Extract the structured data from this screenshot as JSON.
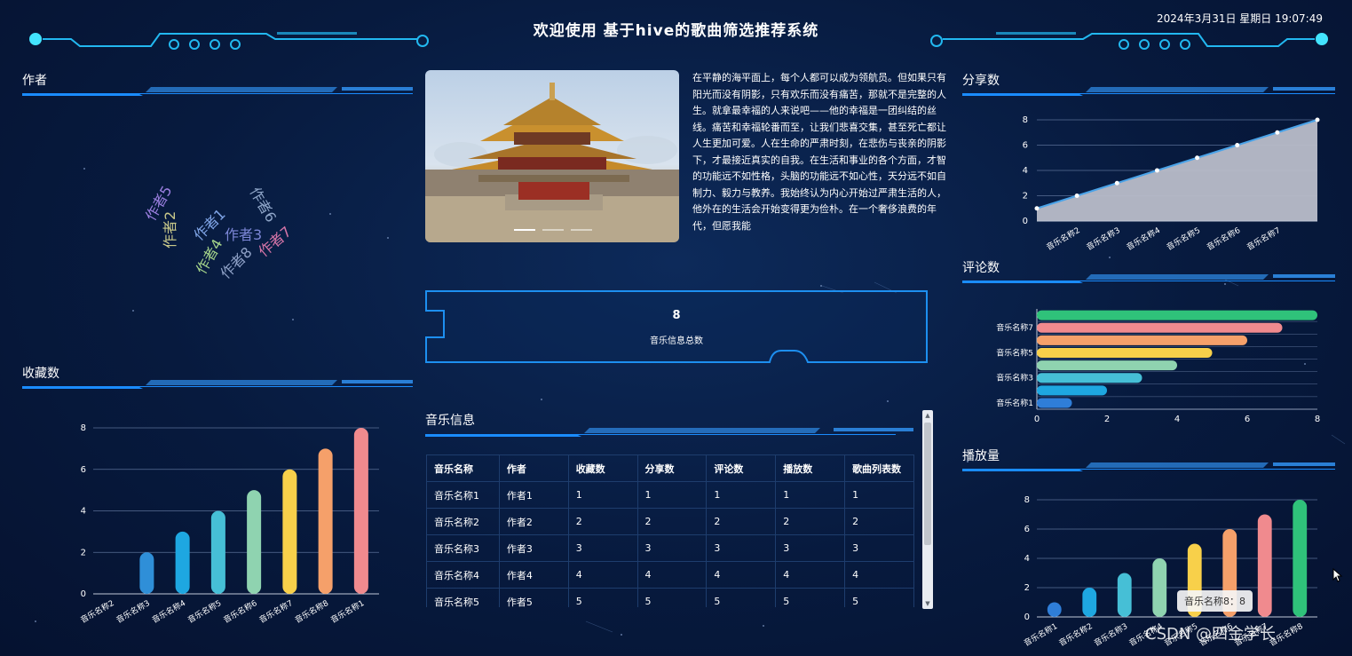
{
  "header": {
    "title": "欢迎使用 基于hive的歌曲筛选推荐系统",
    "datetime": "2024年3月31日 星期日 19:07:49"
  },
  "sections": {
    "author": "作者",
    "favorites": "收藏数",
    "shares": "分享数",
    "comments": "评论数",
    "plays": "播放量",
    "music_info": "音乐信息"
  },
  "intro_text": "在平静的海平面上，每个人都可以成为领航员。但如果只有阳光而没有阴影，只有欢乐而没有痛苦，那就不是完整的人生。就拿最幸福的人来说吧——他的幸福是一团纠结的丝线。痛苦和幸福轮番而至，让我们悲喜交集，甚至死亡都让人生更加可爱。人在生命的严肃时刻，在悲伤与丧亲的阴影下，才最接近真实的自我。在生活和事业的各个方面，才智的功能远不如性格，头脑的功能远不如心性，天分远不如自制力、毅力与教养。我始终认为内心开始过严肃生活的人，他外在的生活会开始变得更为俭朴。在一个奢侈浪费的年代，但愿我能",
  "total": {
    "count": "8",
    "label": "音乐信息总数"
  },
  "word_cloud": [
    {
      "text": "作者5",
      "color": "#9b7fe0"
    },
    {
      "text": "作者2",
      "color": "#c9c98a"
    },
    {
      "text": "作者1",
      "color": "#7fa4e6"
    },
    {
      "text": "作者3",
      "color": "#7b86d6"
    },
    {
      "text": "作者6",
      "color": "#8fa6c9"
    },
    {
      "text": "作者4",
      "color": "#a5d48a"
    },
    {
      "text": "作者8",
      "color": "#8ea0c6"
    },
    {
      "text": "作者7",
      "color": "#d675a8"
    }
  ],
  "table": {
    "headers": [
      "音乐名称",
      "作者",
      "收藏数",
      "分享数",
      "评论数",
      "播放数",
      "歌曲列表数"
    ],
    "rows": [
      [
        "音乐名称1",
        "作者1",
        "1",
        "1",
        "1",
        "1",
        "1"
      ],
      [
        "音乐名称2",
        "作者2",
        "2",
        "2",
        "2",
        "2",
        "2"
      ],
      [
        "音乐名称3",
        "作者3",
        "3",
        "3",
        "3",
        "3",
        "3"
      ],
      [
        "音乐名称4",
        "作者4",
        "4",
        "4",
        "4",
        "4",
        "4"
      ],
      [
        "音乐名称5",
        "作者5",
        "5",
        "5",
        "5",
        "5",
        "5"
      ]
    ]
  },
  "tooltip": "音乐名称8：8",
  "watermark": "CSDN @四金学长",
  "chart_data": [
    {
      "id": "favorites",
      "type": "bar",
      "categories": [
        "音乐名称2",
        "音乐名称3",
        "音乐名称4",
        "音乐名称5",
        "音乐名称6",
        "音乐名称7",
        "音乐名称8",
        "音乐名称1"
      ],
      "values": [
        0,
        2,
        3,
        4,
        5,
        6,
        7,
        8
      ],
      "ylim": [
        0,
        8
      ],
      "yticks": [
        0,
        2,
        4,
        6,
        8
      ],
      "colors": [
        "#2f7ed8",
        "#2f8fd8",
        "#1ea7e1",
        "#46bfd6",
        "#8fd3b0",
        "#f8d04a",
        "#f5a06a",
        "#f08a8e"
      ],
      "grid": true
    },
    {
      "id": "shares",
      "type": "area",
      "categories": [
        "音乐名称1",
        "音乐名称2",
        "音乐名称3",
        "音乐名称4",
        "音乐名称5",
        "音乐名称6",
        "音乐名称7",
        "音乐名称8"
      ],
      "values": [
        1,
        2,
        3,
        4,
        5,
        6,
        7,
        8
      ],
      "ylim": [
        0,
        8
      ],
      "yticks": [
        0,
        2,
        4,
        6,
        8
      ],
      "shown_tick_labels": [
        "音乐名称2",
        "音乐名称3",
        "音乐名称4",
        "音乐名称5",
        "音乐名称6",
        "音乐名称7"
      ],
      "line_color": "#4aa3e8",
      "fill_color": "#b9bdc9",
      "grid": true
    },
    {
      "id": "comments",
      "type": "bar",
      "orientation": "horizontal",
      "categories": [
        "音乐名称1",
        "音乐名称2",
        "音乐名称3",
        "音乐名称4",
        "音乐名称5",
        "音乐名称6",
        "音乐名称7",
        "音乐名称8"
      ],
      "values": [
        1,
        2,
        3,
        4,
        5,
        6,
        7,
        8
      ],
      "xlim": [
        0,
        8
      ],
      "xticks": [
        0,
        2,
        4,
        6,
        8
      ],
      "shown_tick_labels": [
        "音乐名称1",
        "音乐名称3",
        "音乐名称5",
        "音乐名称7"
      ],
      "colors": [
        "#2f7ed8",
        "#1ea7e1",
        "#46bfd6",
        "#8fd3b0",
        "#f8d04a",
        "#f5a06a",
        "#f08a8e",
        "#2fc27a"
      ],
      "grid": true
    },
    {
      "id": "plays",
      "type": "bar",
      "categories": [
        "音乐名称1",
        "音乐名称2",
        "音乐名称3",
        "音乐名称4",
        "音乐名称5",
        "音乐名称6",
        "音乐名称7",
        "音乐名称8"
      ],
      "values": [
        1,
        2,
        3,
        4,
        5,
        6,
        7,
        8
      ],
      "ylim": [
        0,
        8
      ],
      "yticks": [
        0,
        2,
        4,
        6,
        8
      ],
      "colors": [
        "#2f7ed8",
        "#1ea7e1",
        "#46bfd6",
        "#8fd3b0",
        "#f8d04a",
        "#f5a06a",
        "#f08a8e",
        "#2fc27a"
      ],
      "grid": true
    }
  ]
}
